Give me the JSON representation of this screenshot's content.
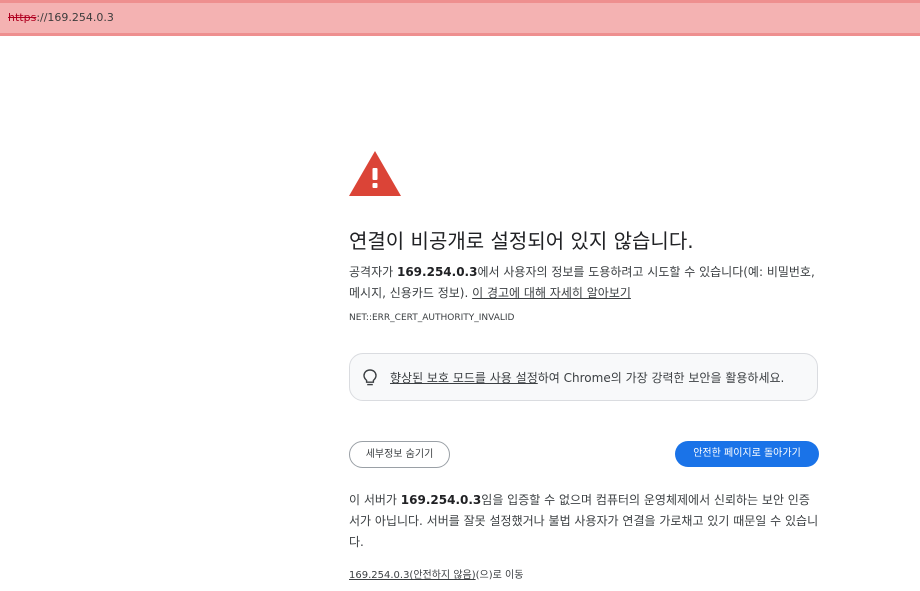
{
  "url_bar": {
    "scheme": "https",
    "rest": "://169.254.0.3"
  },
  "warning_icon": {
    "name": "warning-triangle-icon",
    "color": "#db4437"
  },
  "headline": "연결이 비공개로 설정되어 있지 않습니다.",
  "description": {
    "prefix": "공격자가 ",
    "host": "169.254.0.3",
    "middle": "에서 사용자의 정보를 도용하려고 시도할 수 있습니다(예: 비밀번호, 메시지, 신용카드 정보). ",
    "link": "이 경고에 대해 자세히 알아보기"
  },
  "error_code": "NET::ERR_CERT_AUTHORITY_INVALID",
  "promo": {
    "icon": "lightbulb-icon",
    "link": "향상된 보호 모드를 사용 설정",
    "rest": "하여 Chrome의 가장 강력한 보안을 활용하세요."
  },
  "buttons": {
    "details": "세부정보 숨기기",
    "back": "안전한 페이지로 돌아가기",
    "back_color": "#1a73e8"
  },
  "details_text": {
    "prefix": "이 서버가 ",
    "host": "169.254.0.3",
    "rest": "임을 입증할 수 없으며 컴퓨터의 운영체제에서 신뢰하는 보안 인증서가 아닙니다. 서버를 잘못 설정했거나 불법 사용자가 연결을 가로채고 있기 때문일 수 있습니다."
  },
  "proceed": {
    "link": "169.254.0.3(안전하지 않음)",
    "rest": "(으)로 이동"
  }
}
